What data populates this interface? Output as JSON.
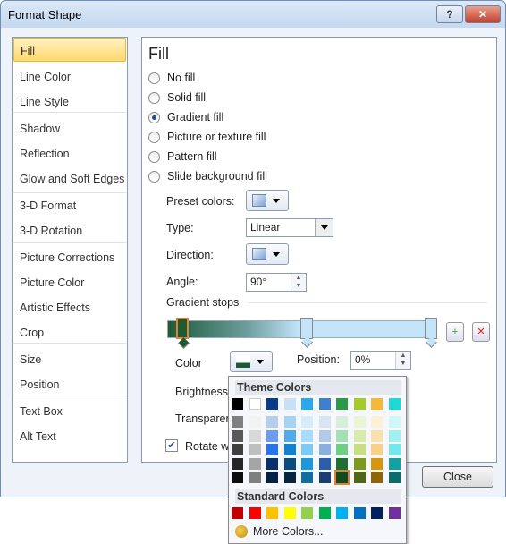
{
  "window": {
    "title": "Format Shape",
    "help_label": "?",
    "close_label": "✕"
  },
  "sidebar": {
    "items": [
      {
        "label": "Fill",
        "selected": true
      },
      {
        "label": "Line Color"
      },
      {
        "label": "Line Style"
      },
      {
        "label": "Shadow"
      },
      {
        "label": "Reflection"
      },
      {
        "label": "Glow and Soft Edges"
      },
      {
        "label": "3-D Format"
      },
      {
        "label": "3-D Rotation"
      },
      {
        "label": "Picture Corrections"
      },
      {
        "label": "Picture Color"
      },
      {
        "label": "Artistic Effects"
      },
      {
        "label": "Crop"
      },
      {
        "label": "Size"
      },
      {
        "label": "Position"
      },
      {
        "label": "Text Box"
      },
      {
        "label": "Alt Text"
      }
    ]
  },
  "fill": {
    "heading": "Fill",
    "options": [
      {
        "label": "No fill"
      },
      {
        "label": "Solid fill"
      },
      {
        "label": "Gradient fill",
        "selected": true
      },
      {
        "label": "Picture or texture fill"
      },
      {
        "label": "Pattern fill"
      },
      {
        "label": "Slide background fill"
      }
    ],
    "preset_label": "Preset colors:",
    "type_label": "Type:",
    "type_value": "Linear",
    "direction_label": "Direction:",
    "angle_label": "Angle:",
    "angle_value": "90°",
    "stops_label": "Gradient stops",
    "color_label": "Color",
    "position_label": "Position:",
    "position_value": "0%",
    "brightness_label": "Brightness",
    "transparency_label": "Transparency",
    "rotate_label": "Rotate with shape",
    "rotate_checked": true
  },
  "close_button": "Close",
  "palette": {
    "theme_label": "Theme Colors",
    "standard_label": "Standard Colors",
    "more_label": "More Colors...",
    "theme_top": [
      "#000000",
      "#ffffff",
      "#0b3c8c",
      "#c6e0f8",
      "#2aa8ee",
      "#3f7fcf",
      "#2b9a48",
      "#a3cc2a",
      "#f3b93a",
      "#1fd8d8"
    ],
    "theme_shades": [
      [
        "#7f7f7f",
        "#595959",
        "#3f3f3f",
        "#262626",
        "#0d0d0d"
      ],
      [
        "#f2f2f2",
        "#d8d8d8",
        "#bfbfbf",
        "#a5a5a5",
        "#7f7f7f"
      ],
      [
        "#b6cdf2",
        "#6d9cea",
        "#2a73e8",
        "#08306a",
        "#051f46"
      ],
      [
        "#a7d3f3",
        "#51abe9",
        "#1380d0",
        "#0a4d7d",
        "#06263f"
      ],
      [
        "#d4ecfb",
        "#aadbf8",
        "#7ec8f4",
        "#1b98dd",
        "#0f6da0"
      ],
      [
        "#d8e4f4",
        "#b1caea",
        "#8aafdf",
        "#2b5ea8",
        "#1b3d70"
      ],
      [
        "#d4f0da",
        "#a5e0b4",
        "#6fcd85",
        "#1f6e33",
        "#14491f"
      ],
      [
        "#ecf5d3",
        "#d9ebaa",
        "#c6e07f",
        "#7c9a1c",
        "#516613"
      ],
      [
        "#fcf0d7",
        "#f9e1af",
        "#f6d288",
        "#d6970c",
        "#8f6508"
      ],
      [
        "#d0f7f7",
        "#a1f0f0",
        "#72e8e8",
        "#13a2a2",
        "#0c6c6c"
      ]
    ],
    "selected": [
      6,
      4
    ],
    "standard": [
      "#c00000",
      "#ff0000",
      "#ffc000",
      "#ffff00",
      "#92d050",
      "#00b050",
      "#00b0f0",
      "#0070c0",
      "#002060",
      "#7030a0"
    ]
  }
}
